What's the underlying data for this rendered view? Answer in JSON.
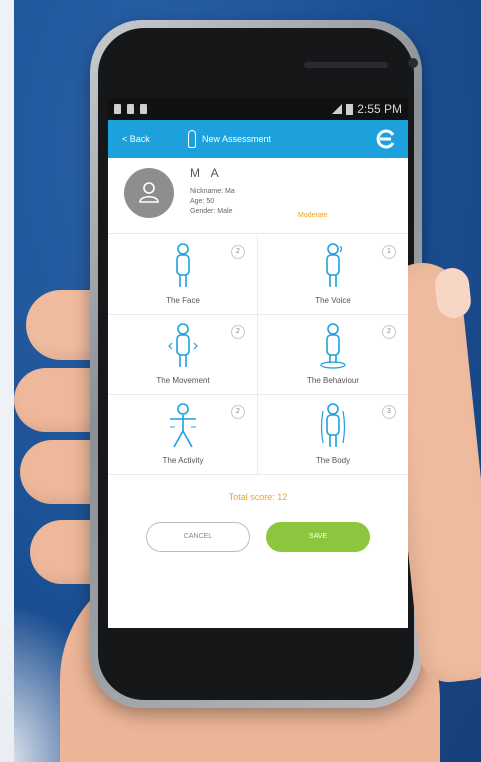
{
  "status_bar": {
    "time": "2:55 PM"
  },
  "header": {
    "back_label": "< Back",
    "title": "New Assessment"
  },
  "profile": {
    "initials": "M A",
    "nickname": "Nickname: Ma",
    "age": "Age: 50",
    "gender": "Gender: Male",
    "severity": "Moderate"
  },
  "categories": [
    {
      "label": "The Face",
      "score": "2"
    },
    {
      "label": "The Voice",
      "score": "1"
    },
    {
      "label": "The Movement",
      "score": "2"
    },
    {
      "label": "The Behaviour",
      "score": "2"
    },
    {
      "label": "The Activity",
      "score": "2"
    },
    {
      "label": "The Body",
      "score": "3"
    }
  ],
  "total_score": "Total score: 12",
  "actions": {
    "cancel_label": "CANCEL",
    "save_label": "SAVE"
  },
  "colors": {
    "header": "#1da1dc",
    "accent": "#f0a21c",
    "save": "#8cc63f",
    "icon": "#1da1dc"
  },
  "icons": [
    "person-icon",
    "logo-icon",
    "avatar-icon",
    "face-figure-icon",
    "voice-figure-icon",
    "movement-figure-icon",
    "behaviour-figure-icon",
    "activity-figure-icon",
    "body-figure-icon"
  ]
}
